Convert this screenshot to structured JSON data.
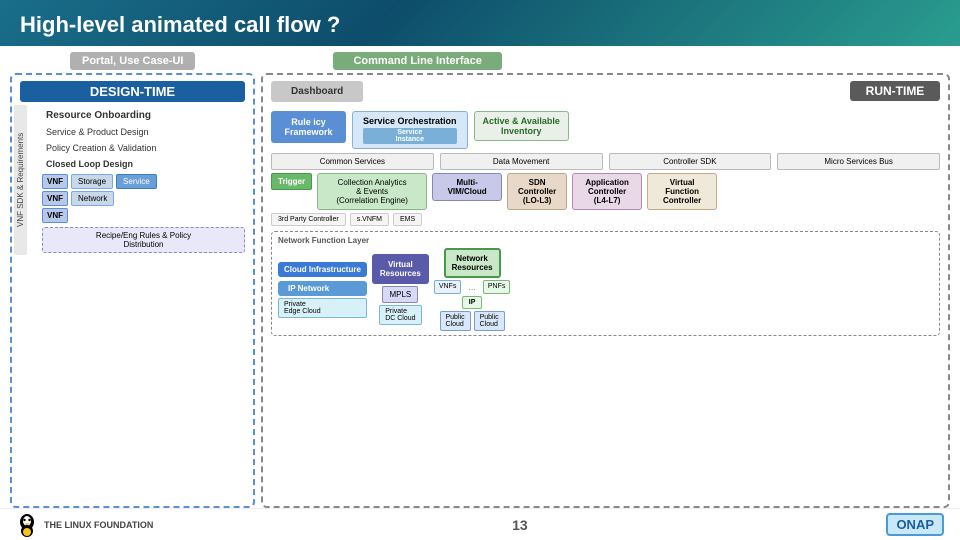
{
  "header": {
    "title": "High-level animated call flow ?"
  },
  "top_labels": {
    "portal": "Portal, Use Case-UI",
    "cli": "Command Line Interface"
  },
  "design_time": {
    "label": "DESIGN-TIME",
    "vnf_sdk_label": "VNF SDK & Requirements",
    "resource_onboarding": "Resource Onboarding",
    "service_product_design": "Service & Product Design",
    "policy_creation": "Policy Creation & Validation",
    "closed_loop": "Closed Loop Design",
    "vnf1": "VNF",
    "vnf2": "VNF",
    "vnf3": "VNF",
    "storage": "Storage",
    "network": "Network",
    "service": "Service",
    "recipe_label": "Recipe/Eng Rules & Policy\nDistribution"
  },
  "run_time": {
    "label": "RUN-TIME",
    "dashboard": "Dashboard",
    "rule_policy": "Rule     icy\nFramework",
    "service_orchestration": "Service Orchestration",
    "service_instance": "Service\nInstance",
    "active_inventory": "Active & Available\nInventory",
    "common_services": "Common Services",
    "data_movement": "Data Movement",
    "controller_sdk": "Controller SDK",
    "micro_services_bus": "Micro Services Bus",
    "trigger": "Trigger",
    "collection_analytics": "Collection Analytics\n& Events\n(Correlation Engine)",
    "multi_vim": "Multi-VIM/Cloud",
    "sdn_controller": "SDN\nController\n(LO-L3)",
    "app_controller": "Application\nController\n(L4-L7)",
    "vfc": "Virtual Function\nController",
    "third_party": "3rd Party Controller",
    "s_vnfm": "s.VNFM",
    "ems": "EMS",
    "network_func_layer": "Network Function Layer",
    "cloud_infra": "Cloud Infrastructure",
    "ip_network": "IP Network",
    "virtual_resources": "Virtual\nResources",
    "network_resources": "Network\nResources",
    "mpls": "MPLS",
    "vnfs": "VNFs",
    "pnfs": "PNFs",
    "dots": "...",
    "private_edge_cloud": "Private\nEdge Cloud",
    "public_cloud_1": "Public\nCloud",
    "private_dc_cloud": "Private\nDC Cloud",
    "public_cloud_2": "Public\nCloud",
    "ip": "IP"
  },
  "footer": {
    "linux_foundation": "THE LINUX FOUNDATION",
    "page_number": "13",
    "onap": "ONAP"
  }
}
